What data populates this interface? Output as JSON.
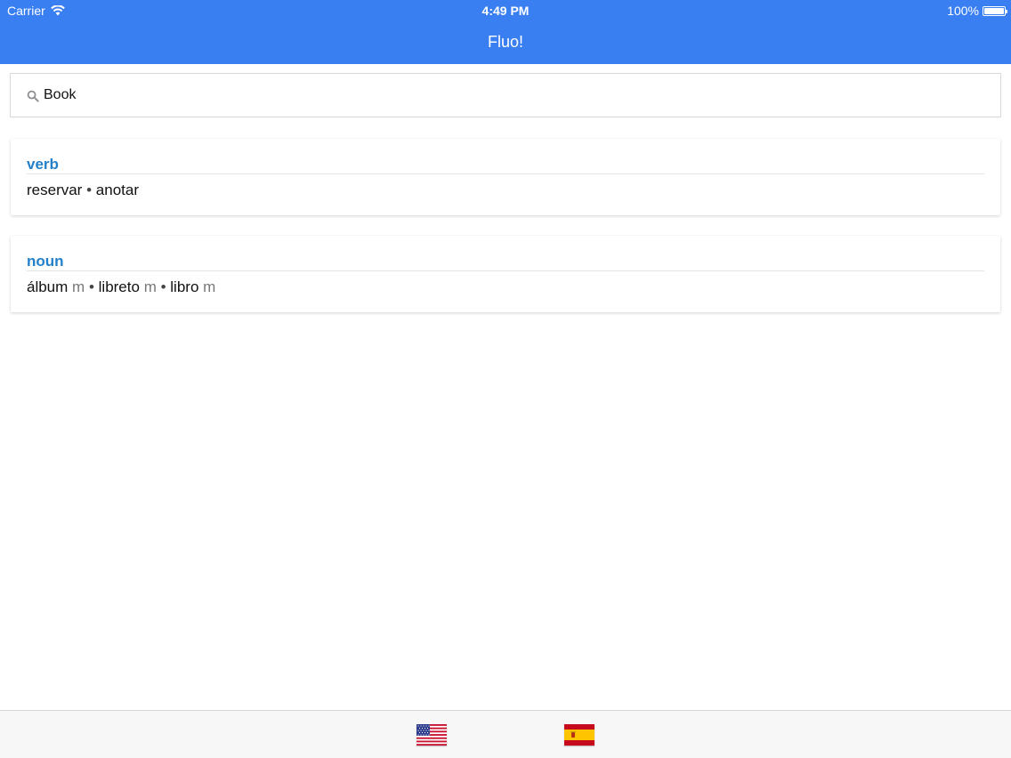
{
  "status_bar": {
    "carrier": "Carrier",
    "time": "4:49 PM",
    "battery": "100%"
  },
  "nav": {
    "title": "Fluo!"
  },
  "search": {
    "value": "Book",
    "placeholder": ""
  },
  "entries": [
    {
      "part_of_speech": "verb",
      "translations": [
        {
          "word": "reservar",
          "gender": ""
        },
        {
          "word": "anotar",
          "gender": ""
        }
      ]
    },
    {
      "part_of_speech": "noun",
      "translations": [
        {
          "word": "álbum",
          "gender": "m"
        },
        {
          "word": "libreto",
          "gender": "m"
        },
        {
          "word": "libro",
          "gender": "m"
        }
      ]
    }
  ],
  "separator": "•",
  "languages": [
    {
      "icon": "us-flag-icon"
    },
    {
      "icon": "spain-flag-icon"
    }
  ],
  "colors": {
    "nav_background": "#3a7ff1",
    "part_of_speech": "#2480c8",
    "gender": "#777777"
  }
}
